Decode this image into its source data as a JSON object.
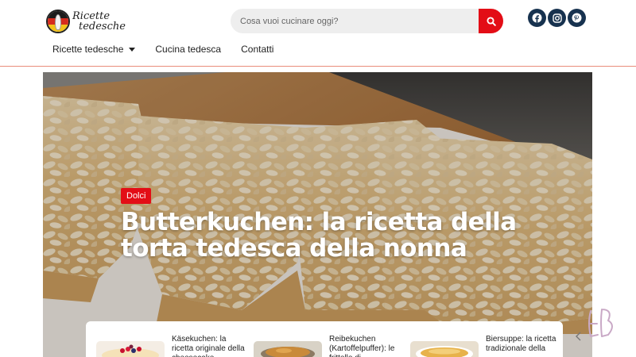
{
  "header": {
    "logo": {
      "line1": "Ricette",
      "line2": "tedesche"
    },
    "search": {
      "placeholder": "Cosa vuoi cucinare oggi?",
      "icon": "search-icon"
    },
    "socials": [
      {
        "name": "facebook-icon"
      },
      {
        "name": "instagram-icon"
      },
      {
        "name": "pinterest-icon"
      }
    ],
    "nav": [
      {
        "label": "Ricette tedesche",
        "has_dropdown": true
      },
      {
        "label": "Cucina tedesca",
        "has_dropdown": false
      },
      {
        "label": "Contatti",
        "has_dropdown": false
      }
    ]
  },
  "hero": {
    "category": "Dolci",
    "title": "Butterkuchen: la ricetta della torta tedesca della nonna"
  },
  "related": [
    {
      "title": "Käsekuchen: la ricetta originale della cheesecake"
    },
    {
      "title": "Reibekuchen (Kartoffelpuffer): le frittelle di"
    },
    {
      "title": "Biersuppe: la ricetta tradizionale della"
    }
  ],
  "colors": {
    "accent": "#e30d16",
    "social_bg": "#17324f",
    "header_rule": "#e98d7a"
  }
}
